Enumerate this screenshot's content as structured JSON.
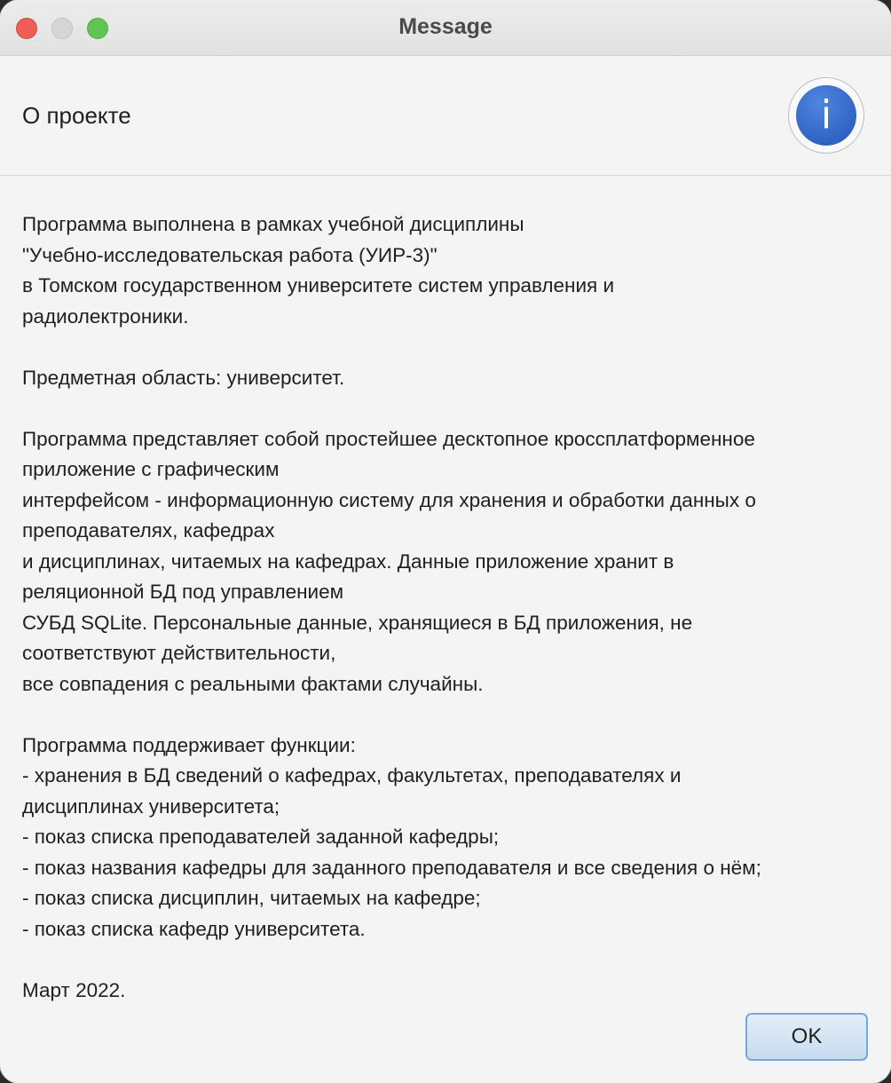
{
  "window": {
    "title": "Message"
  },
  "header": {
    "title": "О проекте",
    "icon": "info-icon",
    "icon_glyph": "i"
  },
  "message": {
    "paragraphs": [
      [
        "Программа выполнена в рамках учебной дисциплины",
        "\"Учебно-исследовательская работа (УИР-3)\"",
        "в Томском государственном университете систем управления и",
        "радиолектроники."
      ],
      [
        "Предметная область: университет."
      ],
      [
        "Программа представляет собой простейшее десктопное кроссплатформенное",
        "приложение с графическим",
        "интерфейсом - информационную систему для хранения и обработки данных о",
        "преподавателях, кафедрах",
        "и дисциплинах, читаемых на кафедрах. Данные приложение хранит в",
        "реляционной БД под управлением",
        "СУБД SQLite. Персональные данные, хранящиеся в БД приложения, не",
        "соответствуют действительности,",
        "все совпадения с реальными фактами случайны."
      ],
      [
        "Программа поддерживает функции:",
        "- хранения в БД сведений о кафедрах, факультетах, преподавателях и",
        "дисциплинах университета;",
        "- показ списка преподавателей заданной кафедры;",
        "- показ названия кафедры для заданного преподавателя и все сведения о нём;",
        "- показ списка дисциплин, читаемых на кафедре;",
        "- показ списка кафедр университета."
      ],
      [
        "Март 2022."
      ]
    ]
  },
  "buttons": {
    "ok_label": "OK"
  },
  "colors": {
    "close": "#ee5e57",
    "minimize": "#d6d6d6",
    "maximize": "#60c554",
    "info_icon": "#2f66c8",
    "ok_border": "#74a8df"
  }
}
